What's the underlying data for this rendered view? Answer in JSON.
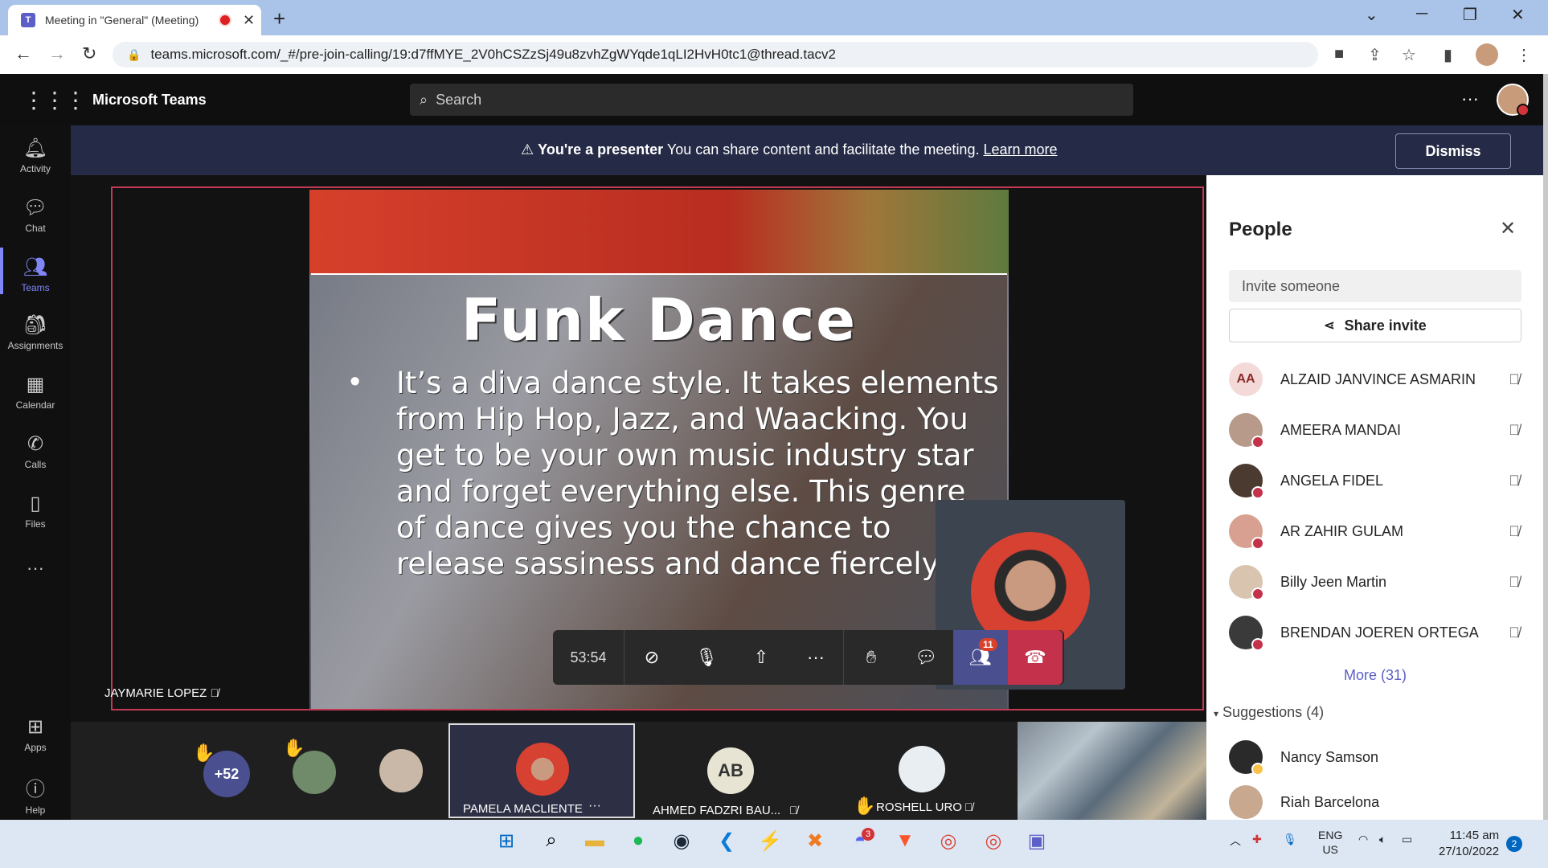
{
  "browser": {
    "tab_title": "Meeting in \"General\" (Meeting)",
    "url": "teams.microsoft.com/_#/pre-join-calling/19:d7ffMYE_2V0hCSZzSj49u8zvhZgWYqde1qLI2HvH0tc1@thread.tacv2"
  },
  "header": {
    "app_title": "Microsoft Teams",
    "search_placeholder": "Search"
  },
  "rail": {
    "items": [
      {
        "label": "Activity",
        "icon": "bell-icon"
      },
      {
        "label": "Chat",
        "icon": "chat-icon"
      },
      {
        "label": "Teams",
        "icon": "teams-icon"
      },
      {
        "label": "Assignments",
        "icon": "assignments-icon"
      },
      {
        "label": "Calendar",
        "icon": "calendar-icon"
      },
      {
        "label": "Calls",
        "icon": "phone-icon"
      },
      {
        "label": "Files",
        "icon": "file-icon"
      },
      {
        "label": "Apps",
        "icon": "apps-icon"
      },
      {
        "label": "Help",
        "icon": "help-icon"
      }
    ]
  },
  "banner": {
    "bold": "You're a presenter",
    "text": "You can share content and facilitate the meeting.",
    "link": "Learn more",
    "dismiss": "Dismiss"
  },
  "slide": {
    "title": "Funk Dance",
    "bullet": "•",
    "body": "It’s a diva dance style. It takes elements from Hip Hop, Jazz, and Waacking. You get to be your own music industry star and forget everything else. This genre of dance gives you the chance to release sassiness and dance fiercely"
  },
  "stage": {
    "speaker": "JAYMARIE LOPEZ"
  },
  "controls": {
    "timer": "53:54",
    "participants_badge": "11"
  },
  "gallery": {
    "overflow": "+52",
    "selected_name": "PAMELA MACLIENTE",
    "ahmed_initials": "AB",
    "ahmed_name": "AHMED FADZRI BAU...",
    "roshell_name": "ROSHELL URO"
  },
  "people_panel": {
    "title": "People",
    "invite_placeholder": "Invite someone",
    "share_invite": "Share invite",
    "people": [
      {
        "name": "ALZAID JANVINCE ASMARIN",
        "initials": "AA"
      },
      {
        "name": "AMEERA MANDAI"
      },
      {
        "name": "ANGELA FIDEL"
      },
      {
        "name": "AR ZAHIR GULAM"
      },
      {
        "name": "Billy Jeen Martin"
      },
      {
        "name": "BRENDAN JOEREN ORTEGA"
      }
    ],
    "more": "More (31)",
    "suggestions_label": "Suggestions (4)",
    "suggestions": [
      {
        "name": "Nancy Samson"
      },
      {
        "name": "Riah Barcelona"
      }
    ]
  },
  "taskbar": {
    "lang_top": "ENG",
    "lang_bottom": "US",
    "time": "11:45 am",
    "date": "27/10/2022",
    "notif_count": "2",
    "discord_badge": "3"
  },
  "colors": {
    "accent": "#5b5fc7",
    "banner_bg": "#252a46",
    "hangup": "#c4314b",
    "presenter_border": "#c33a55"
  }
}
